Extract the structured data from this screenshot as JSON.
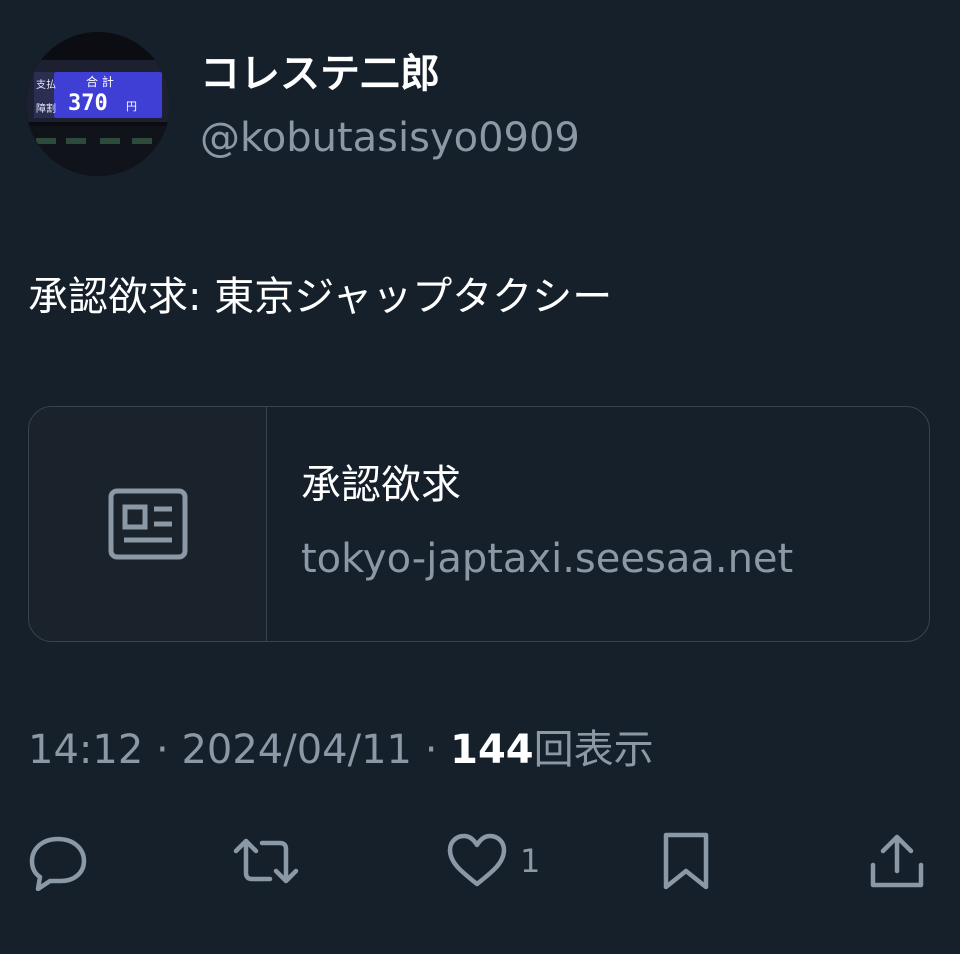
{
  "author": {
    "display_name": "コレステ二郎",
    "handle": "@kobutasisyo0909",
    "avatar": {
      "icon": "taxi-meter-avatar",
      "meter_labels": {
        "pay": "支払",
        "total": "合 計",
        "fare": "370",
        "currency": "円",
        "discount": "障割"
      }
    }
  },
  "tweet": {
    "text": "承認欲求: 東京ジャップタクシー"
  },
  "link_card": {
    "icon": "article-icon",
    "title": "承認欲求",
    "domain": "tokyo-japtaxi.seesaa.net"
  },
  "meta": {
    "time": "14:12",
    "separator": "·",
    "date": "2024/04/11",
    "views_count": "144",
    "views_label": "回表示"
  },
  "actions": {
    "reply_icon": "reply-icon",
    "retweet_icon": "retweet-icon",
    "like_icon": "heart-icon",
    "like_count": "1",
    "bookmark_icon": "bookmark-icon",
    "share_icon": "share-icon"
  },
  "colors": {
    "background": "#15202b",
    "primary_text": "#ffffff",
    "secondary_text": "#8b98a5",
    "border": "#38444d"
  }
}
